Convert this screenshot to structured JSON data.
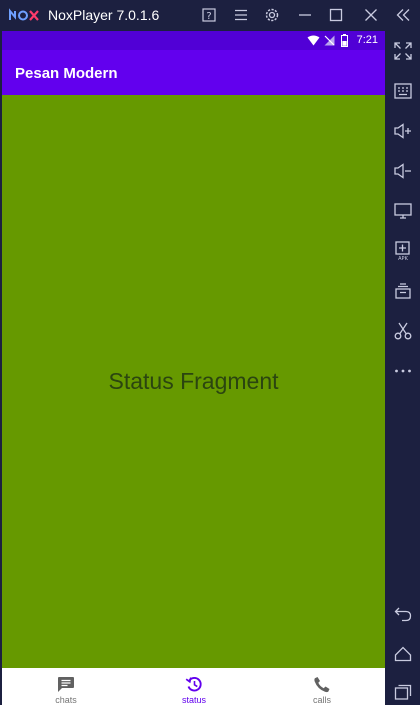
{
  "window": {
    "title": "NoxPlayer 7.0.1.6"
  },
  "phone": {
    "status_time": "7:21",
    "app_title": "Pesan Modern",
    "fragment_text": "Status Fragment",
    "nav": {
      "chats": "chats",
      "status": "status",
      "calls": "calls"
    }
  },
  "colors": {
    "appbar": "#6200ee",
    "statusbar": "#5100d6",
    "content": "#669900",
    "active_nav": "#6200ee"
  },
  "sidebar_tools": [
    "fullscreen-icon",
    "keyboard-icon",
    "volume-up-icon",
    "volume-down-icon",
    "screen-icon",
    "apk-install-icon",
    "multi-instance-icon",
    "scissors-icon",
    "more-icon",
    "back-icon",
    "home-icon",
    "recents-icon"
  ]
}
